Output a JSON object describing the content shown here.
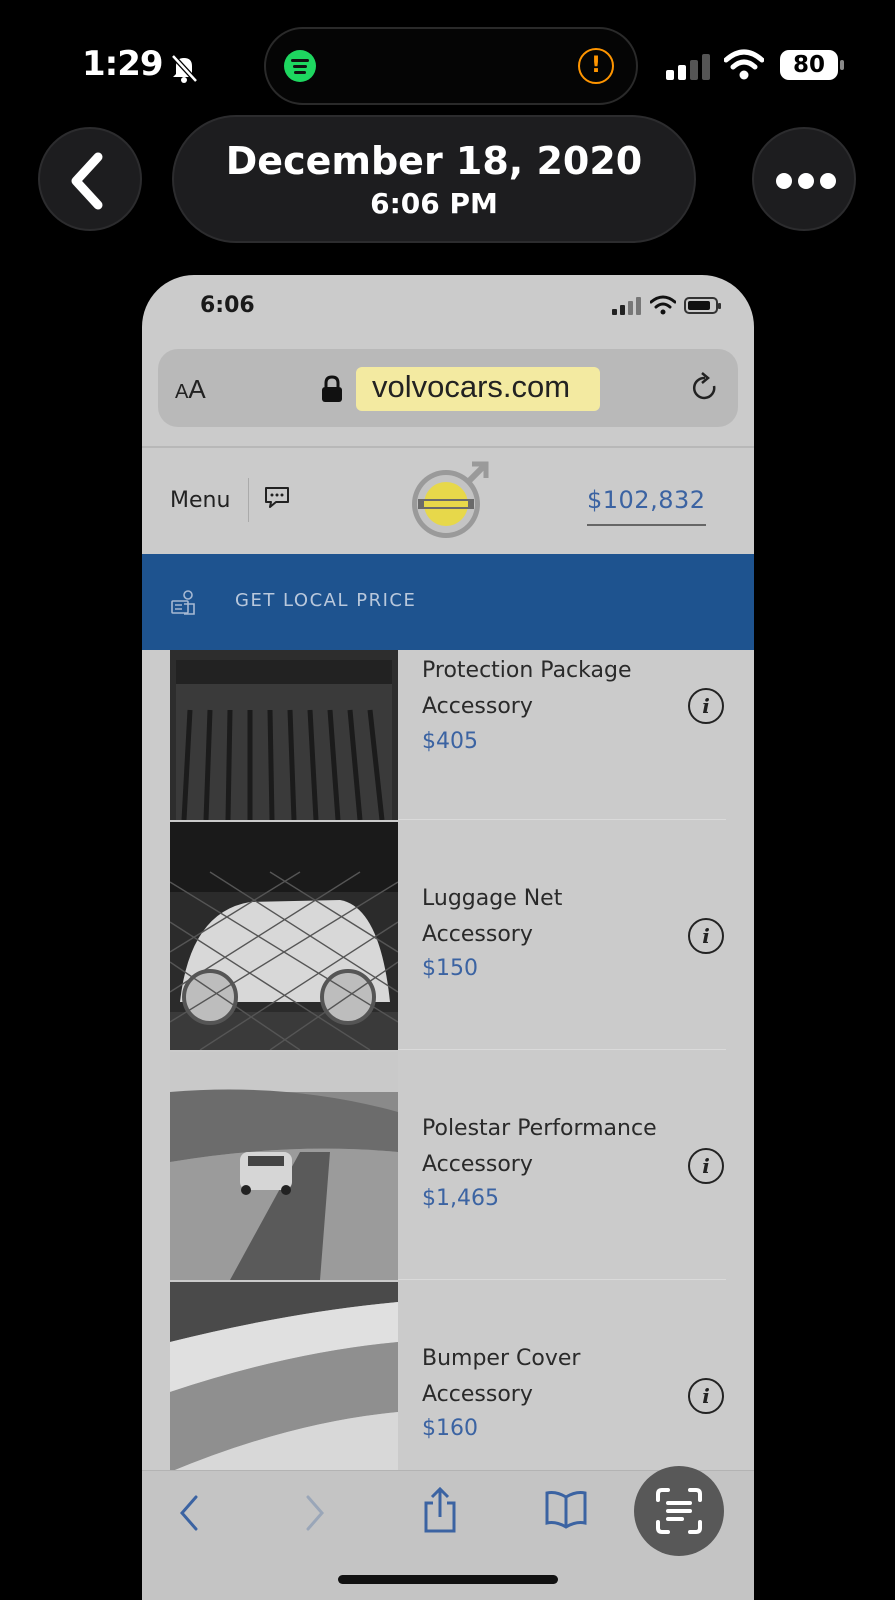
{
  "status_bar": {
    "time": "1:29",
    "battery": "80"
  },
  "photo_header": {
    "date": "December 18, 2020",
    "time": "6:06 PM"
  },
  "phone": {
    "status_time": "6:06",
    "url": "volvocars.com",
    "text_size_label_small": "A",
    "text_size_label_large": "A",
    "menu_label": "Menu",
    "total_price": "$102,832",
    "cta_label": "GET LOCAL PRICE",
    "items": [
      {
        "name": "Protection Package",
        "type": "Accessory",
        "price": "$405"
      },
      {
        "name": "Luggage Net",
        "type": "Accessory",
        "price": "$150"
      },
      {
        "name": "Polestar Performance",
        "type": "Accessory",
        "price": "$1,465"
      },
      {
        "name": "Bumper Cover",
        "type": "Accessory",
        "price": "$160"
      }
    ],
    "info_glyph": "i"
  },
  "colors": {
    "cta_blue": "#1e538f",
    "price_blue": "#3b63a2",
    "url_highlight": "#f3eaa1",
    "spotify_green": "#1ed760",
    "alert_orange": "#ff9500"
  },
  "icons": [
    "bell-slash-icon",
    "spotify-icon",
    "alert-icon",
    "cellular-signal-icon",
    "wifi-icon",
    "battery-icon",
    "chevron-left-icon",
    "ellipsis-icon",
    "lock-icon",
    "reload-icon",
    "chat-icon",
    "volvo-logo",
    "dealer-location-icon",
    "info-icon",
    "share-icon",
    "bookmarks-icon",
    "text-scan-icon"
  ]
}
